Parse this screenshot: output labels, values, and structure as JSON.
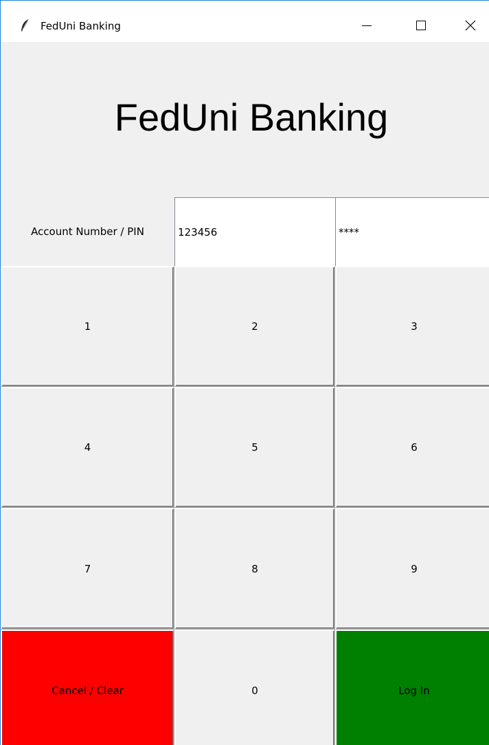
{
  "window": {
    "title": "FedUni Banking"
  },
  "heading": "FedUni Banking",
  "login_form": {
    "label": "Account Number / PIN",
    "account_number": "123456",
    "pin_masked": "****"
  },
  "keypad": {
    "k1": "1",
    "k2": "2",
    "k3": "3",
    "k4": "4",
    "k5": "5",
    "k6": "6",
    "k7": "7",
    "k8": "8",
    "k9": "9",
    "k0": "0",
    "cancel": "Cancel / Clear",
    "login": "Log In"
  },
  "colors": {
    "cancel_button": "#ff0000",
    "login_button": "#008000"
  }
}
